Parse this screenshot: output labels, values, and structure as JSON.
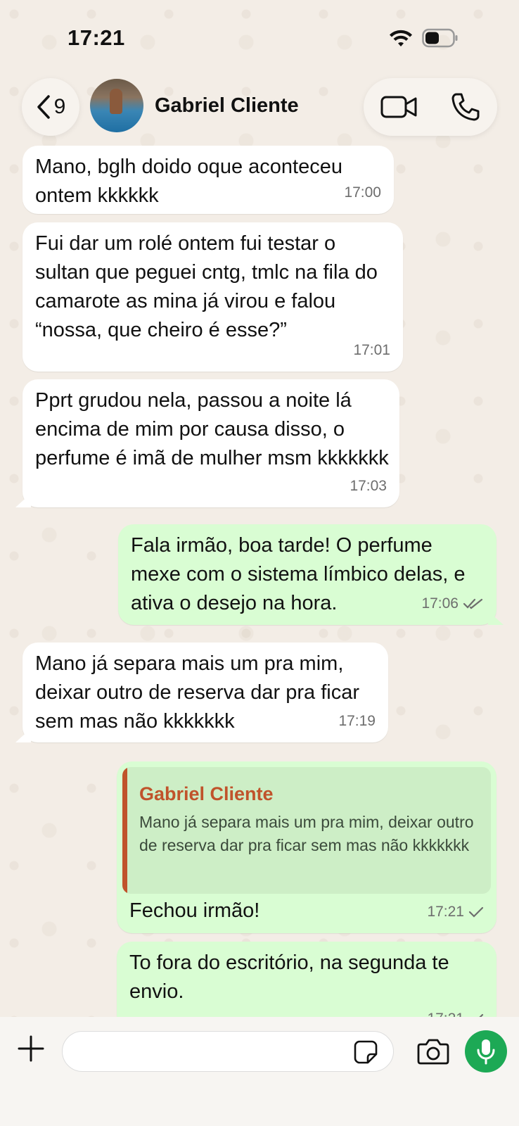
{
  "status_bar": {
    "time": "17:21"
  },
  "header": {
    "back_count": "9",
    "contact_name": "Gabriel Cliente"
  },
  "messages": [
    {
      "direction": "incoming",
      "text": "Mano, bglh doido oque aconteceu ontem kkkkkk",
      "time": "17:00"
    },
    {
      "direction": "incoming",
      "text": "Fui dar um rolé ontem fui testar o sultan que peguei cntg, tmlc na fila do camarote as mina já virou e falou “nossa, que cheiro é esse?”",
      "time": "17:01"
    },
    {
      "direction": "incoming",
      "text": "Pprt grudou nela, passou a noite lá encima de mim por causa disso, o perfume é imã de mulher msm kkkkkkk",
      "time": "17:03"
    },
    {
      "direction": "outgoing",
      "text": "Fala irmão, boa tarde! O perfume mexe com o sistema límbico delas, e ativa o desejo na hora.",
      "time": "17:06",
      "status": "read"
    },
    {
      "direction": "incoming",
      "text": "Mano já separa mais um pra mim, deixar outro de reserva dar pra ficar sem mas não kkkkkkk",
      "time": "17:19"
    },
    {
      "direction": "outgoing",
      "reply_to": {
        "author": "Gabriel Cliente",
        "text": "Mano já separa mais um pra mim, deixar outro de reserva dar pra ficar sem mas não kkkkkkk"
      },
      "text": "Fechou irmão!",
      "time": "17:21",
      "status": "sent"
    },
    {
      "direction": "outgoing",
      "text": "To fora do escritório, na segunda te envio.",
      "time": "17:21",
      "status": "sent"
    }
  ],
  "composer": {
    "placeholder": ""
  },
  "colors": {
    "outgoing_bubble": "#d9fdd3",
    "incoming_bubble": "#ffffff",
    "reply_accent": "#c0532b",
    "mic_button": "#1da955"
  }
}
